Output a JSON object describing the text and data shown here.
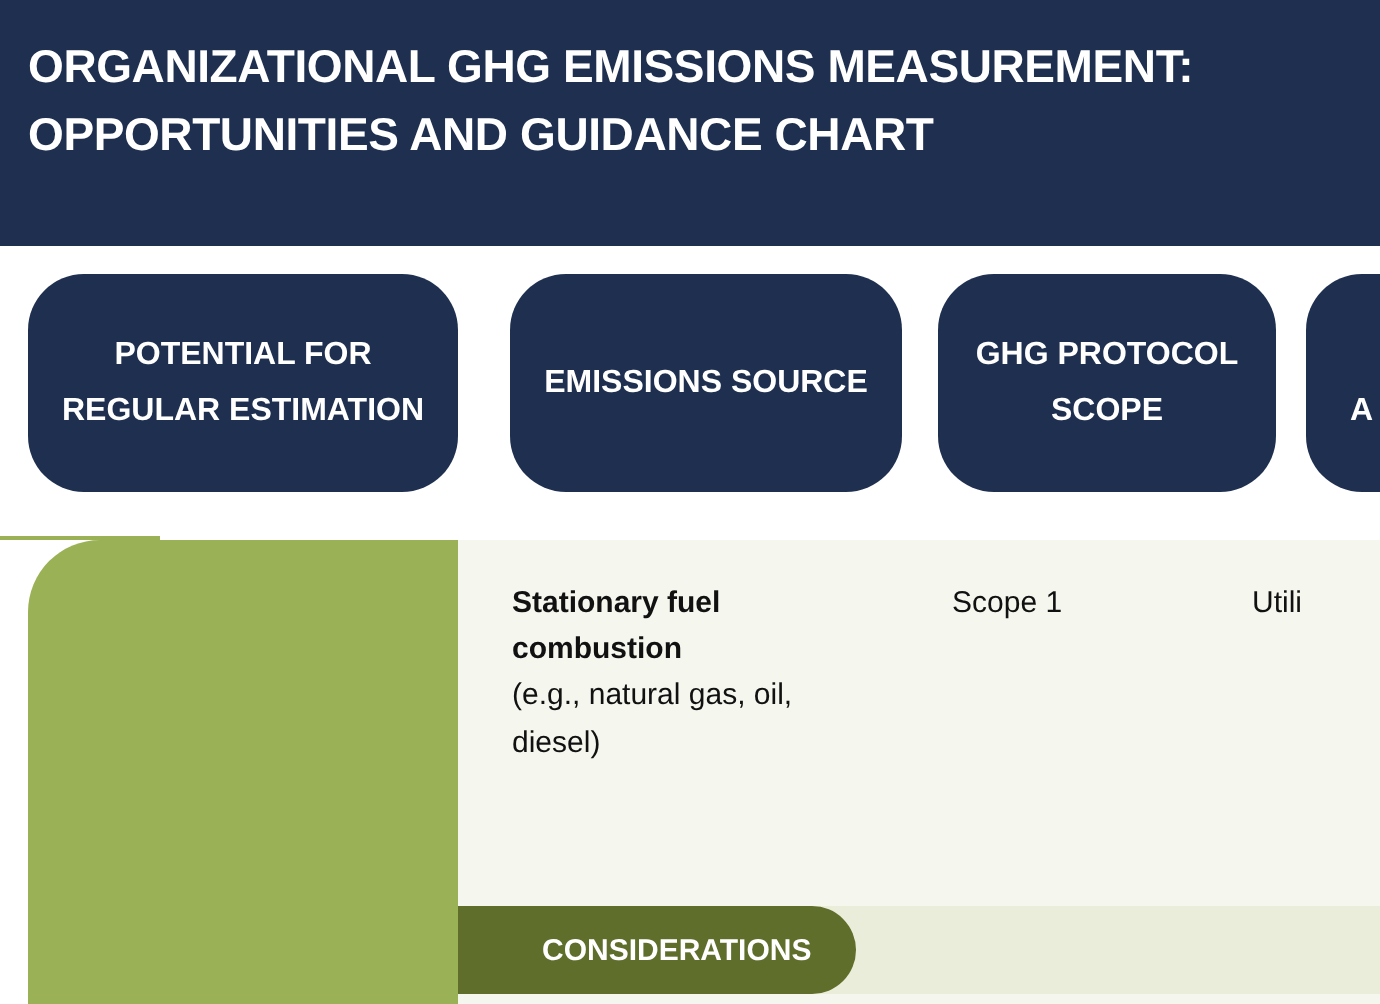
{
  "header": {
    "title": "ORGANIZATIONAL GHG EMISSIONS MEASUREMENT: OPPORTUNITIES AND GUIDANCE CHART"
  },
  "columns": [
    {
      "label": "POTENTIAL FOR REGULAR ESTIMATION"
    },
    {
      "label": "EMISSIONS SOURCE"
    },
    {
      "label": "GHG PROTOCOL SCOPE"
    },
    {
      "label": "A"
    }
  ],
  "rows": [
    {
      "source_title": "Stationary fuel combustion",
      "source_detail": "(e.g., natural gas, oil, diesel)",
      "scope": "Scope 1",
      "column_4": "Utili",
      "considerations_label": "CONSIDERATIONS"
    }
  ]
}
